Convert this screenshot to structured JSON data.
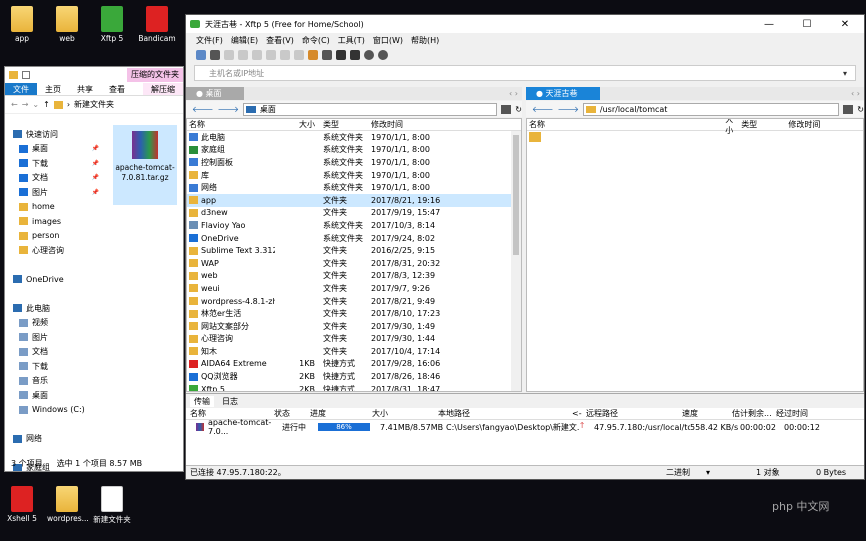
{
  "desktop": {
    "icons": [
      {
        "label": "app"
      },
      {
        "label": "web"
      },
      {
        "label": "Xftp 5"
      },
      {
        "label": "Bandicam"
      }
    ],
    "bottom_icons": [
      {
        "label": "Xshell 5"
      },
      {
        "label": "wordpres..."
      },
      {
        "label": "新建文件夹"
      }
    ]
  },
  "explorer": {
    "ribbon_context": "压缩的文件夹",
    "ribbon_sub": "解压缩",
    "tabs": [
      "文件",
      "主页",
      "共享",
      "查看"
    ],
    "address": "新建文件夹",
    "nav": [
      {
        "label": "快速访问",
        "top": true
      },
      {
        "label": "桌面",
        "pin": true
      },
      {
        "label": "下载",
        "pin": true
      },
      {
        "label": "文档",
        "pin": true
      },
      {
        "label": "图片",
        "pin": true
      },
      {
        "label": "home"
      },
      {
        "label": "images"
      },
      {
        "label": "person"
      },
      {
        "label": "心理咨询"
      },
      {
        "label": ""
      },
      {
        "label": "OneDrive",
        "top": true
      },
      {
        "label": ""
      },
      {
        "label": "此电脑",
        "top": true
      },
      {
        "label": "视频"
      },
      {
        "label": "图片"
      },
      {
        "label": "文档"
      },
      {
        "label": "下载"
      },
      {
        "label": "音乐"
      },
      {
        "label": "桌面"
      },
      {
        "label": "Windows (C:)"
      },
      {
        "label": ""
      },
      {
        "label": "网络",
        "top": true
      },
      {
        "label": ""
      },
      {
        "label": "家庭组",
        "top": true
      }
    ],
    "tile_label": "apache-tomcat-7.0.81.tar.gz",
    "status_count": "3 个项目",
    "status_sel": "选中 1 个项目 8.57 MB"
  },
  "xftp": {
    "title": "天涯古巷 - Xftp 5 (Free for Home/School)",
    "menu": [
      "文件(F)",
      "编辑(E)",
      "查看(V)",
      "命令(C)",
      "工具(T)",
      "窗口(W)",
      "帮助(H)"
    ],
    "host_placeholder": "主机名或IP地址",
    "left_tab": "桌面",
    "right_tab": "天涯古巷",
    "left_path": "桌面",
    "right_path": "/usr/local/tomcat",
    "cols": {
      "name": "名称",
      "size": "大小",
      "type": "类型",
      "date": "修改时间"
    },
    "left_files": [
      {
        "name": "此电脑",
        "size": "",
        "type": "系统文件夹",
        "date": "1970/1/1, 8:00",
        "icon": "#3a7bd5"
      },
      {
        "name": "家庭组",
        "size": "",
        "type": "系统文件夹",
        "date": "1970/1/1, 8:00",
        "icon": "#2a8f3a"
      },
      {
        "name": "控制面板",
        "size": "",
        "type": "系统文件夹",
        "date": "1970/1/1, 8:00",
        "icon": "#3a7bd5"
      },
      {
        "name": "库",
        "size": "",
        "type": "系统文件夹",
        "date": "1970/1/1, 8:00",
        "icon": "#e9b43b"
      },
      {
        "name": "网络",
        "size": "",
        "type": "系统文件夹",
        "date": "1970/1/1, 8:00",
        "icon": "#3a7bd5"
      },
      {
        "name": "app",
        "size": "",
        "type": "文件夹",
        "date": "2017/8/21, 19:16",
        "icon": "#e9b43b",
        "sel": true
      },
      {
        "name": "d3new",
        "size": "",
        "type": "文件夹",
        "date": "2017/9/19, 15:47",
        "icon": "#e9b43b"
      },
      {
        "name": "Flavioy Yao",
        "size": "",
        "type": "系统文件夹",
        "date": "2017/10/3, 8:14",
        "icon": "#6b8fb5"
      },
      {
        "name": "OneDrive",
        "size": "",
        "type": "系统文件夹",
        "date": "2017/9/24, 8:02",
        "icon": "#1a6fd6"
      },
      {
        "name": "Sublime Text 3.312...",
        "size": "",
        "type": "文件夹",
        "date": "2016/2/25, 9:15",
        "icon": "#e9b43b"
      },
      {
        "name": "WAP",
        "size": "",
        "type": "文件夹",
        "date": "2017/8/31, 20:32",
        "icon": "#e9b43b"
      },
      {
        "name": "web",
        "size": "",
        "type": "文件夹",
        "date": "2017/8/3, 12:39",
        "icon": "#e9b43b"
      },
      {
        "name": "weui",
        "size": "",
        "type": "文件夹",
        "date": "2017/9/7, 9:26",
        "icon": "#e9b43b"
      },
      {
        "name": "wordpress-4.8.1-zh...",
        "size": "",
        "type": "文件夹",
        "date": "2017/8/21, 9:49",
        "icon": "#e9b43b"
      },
      {
        "name": "林范er生活",
        "size": "",
        "type": "文件夹",
        "date": "2017/8/10, 17:23",
        "icon": "#e9b43b"
      },
      {
        "name": "网站文案部分",
        "size": "",
        "type": "文件夹",
        "date": "2017/9/30, 1:49",
        "icon": "#e9b43b"
      },
      {
        "name": "心理咨询",
        "size": "",
        "type": "文件夹",
        "date": "2017/9/30, 1:44",
        "icon": "#e9b43b"
      },
      {
        "name": "知木",
        "size": "",
        "type": "文件夹",
        "date": "2017/10/4, 17:14",
        "icon": "#e9b43b"
      },
      {
        "name": "AIDA64 Extreme",
        "size": "1KB",
        "type": "快捷方式",
        "date": "2017/9/28, 16:06",
        "icon": "#d22"
      },
      {
        "name": "QQ浏览器",
        "size": "2KB",
        "type": "快捷方式",
        "date": "2017/8/26, 18:46",
        "icon": "#1a6fd6"
      },
      {
        "name": "Xftp 5",
        "size": "2KB",
        "type": "快捷方式",
        "date": "2017/8/31, 18:47",
        "icon": "#3aa83a"
      }
    ],
    "right_files": [
      {
        "name": "",
        "icon": "#e9b43b"
      }
    ],
    "transfer_tabs": [
      "传输",
      "日志"
    ],
    "transfer_cols": [
      "名称",
      "状态",
      "进度",
      "大小",
      "本地路径",
      "<-",
      "远程路径",
      "速度",
      "估计剩余...",
      "经过时间"
    ],
    "transfer_row": {
      "name": "apache-tomcat-7.0...",
      "status": "进行中",
      "progress": "86%",
      "progress_value": 0.86,
      "size": "7.41MB/8.57MB",
      "local": "C:\\Users\\fangyao\\Desktop\\新建文...",
      "remote": "47.95.7.180:/usr/local/to...",
      "speed": "558.42 KB/s",
      "eta": "00:00:02",
      "elapsed": "00:00:12"
    },
    "status_left": "已连接 47.95.7.180:22。",
    "status_mode": "二进制",
    "status_count": "1 对象",
    "status_bytes": "0 Bytes"
  },
  "watermark": "php 中文网",
  "colors": {
    "tab_active": "#1979ca",
    "pane_left_tab": "#a9a9a9",
    "pane_right_tab": "#1a84d8"
  }
}
